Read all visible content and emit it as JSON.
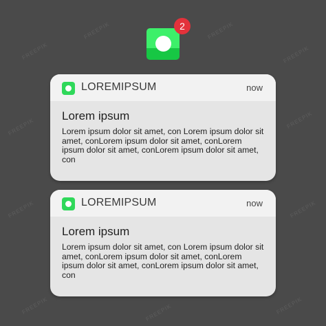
{
  "app_icon": {
    "icon": "app-icon-circle",
    "badge_count": "2",
    "colors": {
      "top": "#3df06a",
      "bottom": "#17c744",
      "badge": "#e3323b"
    }
  },
  "notifications": [
    {
      "app_name": "LOREMIPSUM",
      "time": "now",
      "title": "Lorem ipsum",
      "message": "Lorem ipsum dolor sit amet, con Lorem ipsum dolor sit amet, conLorem ipsum dolor sit amet, conLorem ipsum dolor sit amet, conLorem ipsum dolor sit amet, con"
    },
    {
      "app_name": "LOREMIPSUM",
      "time": "now",
      "title": "Lorem ipsum",
      "message": "Lorem ipsum dolor sit amet, con Lorem ipsum dolor sit amet, conLorem ipsum dolor sit amet, conLorem ipsum dolor sit amet, conLorem ipsum dolor sit amet, con"
    }
  ],
  "watermark": "FREEPIK"
}
